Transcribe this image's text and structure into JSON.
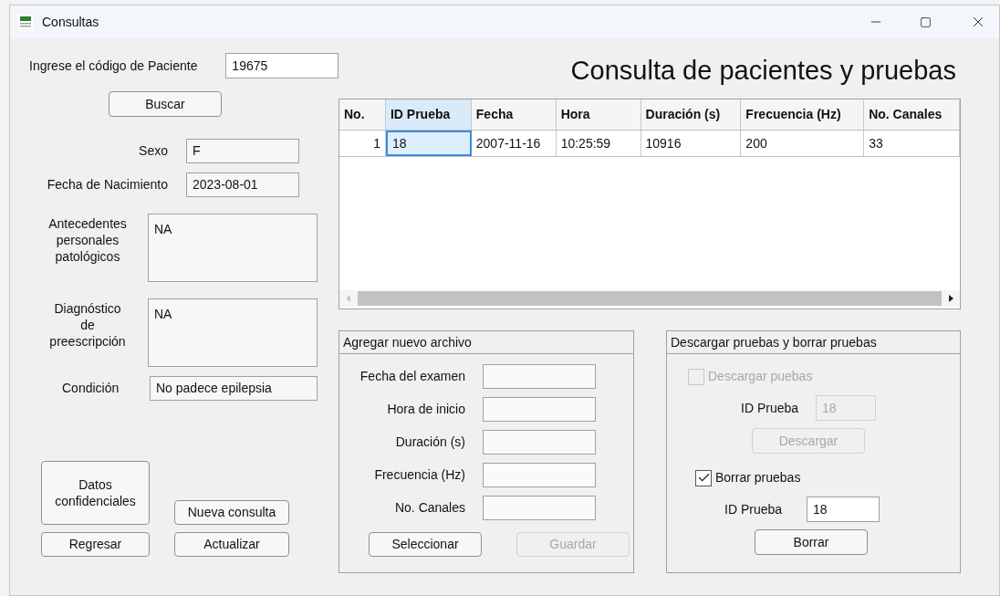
{
  "window": {
    "title": "Consultas"
  },
  "search": {
    "label": "Ingrese el código de Paciente",
    "value": "19675",
    "button": "Buscar"
  },
  "fields": [
    {
      "label": "Sexo",
      "value": "F",
      "kind": "single"
    },
    {
      "label": "Fecha de Nacimiento",
      "value": "2023-08-01",
      "kind": "single"
    },
    {
      "label": "Antecedentes personales patológicos",
      "value": "NA",
      "kind": "multi"
    },
    {
      "label": "Diagnóstico de preescripción",
      "value": "NA",
      "kind": "multi"
    },
    {
      "label": "Condición",
      "value": "No padece epilepsia",
      "kind": "single"
    }
  ],
  "buttons": [
    {
      "label": "Datos confidenciales"
    },
    {
      "label": "Nueva consulta"
    },
    {
      "label": "Regresar"
    },
    {
      "label": "Actualizar"
    }
  ],
  "title": "Consulta de pacientes y pruebas",
  "table": {
    "columns": [
      {
        "label": "No.",
        "selected": false
      },
      {
        "label": "ID Prueba",
        "selected": true
      },
      {
        "label": "Fecha",
        "selected": false
      },
      {
        "label": "Hora",
        "selected": false
      },
      {
        "label": "Duración (s)",
        "selected": false
      },
      {
        "label": "Frecuencia (Hz)",
        "selected": false
      },
      {
        "label": "No. Canales",
        "selected": false
      }
    ],
    "rows": [
      {
        "cells": [
          {
            "text": "1",
            "selected": false
          },
          {
            "text": "18",
            "selected": true
          },
          {
            "text": "2007-11-16",
            "selected": false
          },
          {
            "text": "10:25:59",
            "selected": false
          },
          {
            "text": "10916",
            "selected": false
          },
          {
            "text": "200",
            "selected": false
          },
          {
            "text": "33",
            "selected": false
          }
        ]
      }
    ]
  },
  "add_panel": {
    "title": "Agregar nuevo archivo",
    "fields": [
      {
        "label": "Fecha del examen"
      },
      {
        "label": "Hora de inicio"
      },
      {
        "label": "Duración (s)"
      },
      {
        "label": "Frecuencia (Hz)"
      },
      {
        "label": "No. Canales"
      }
    ],
    "buttons": [
      {
        "label": "Seleccionar",
        "disabled": false
      },
      {
        "label": "Guardar",
        "disabled": true
      }
    ]
  },
  "delete_panel": {
    "title": "Descargar pruebas y borrar pruebas",
    "sections": [
      {
        "check": {
          "label": "Descargar puebas",
          "checked": false,
          "disabled": true
        },
        "id_label": "ID Prueba",
        "id_value": "18",
        "button": "Descargar",
        "disabled": true
      },
      {
        "check": {
          "label": "Borrar pruebas",
          "checked": true,
          "disabled": false
        },
        "id_label": "ID Prueba",
        "id_value": "18",
        "button": "Borrar",
        "disabled": false
      }
    ]
  }
}
